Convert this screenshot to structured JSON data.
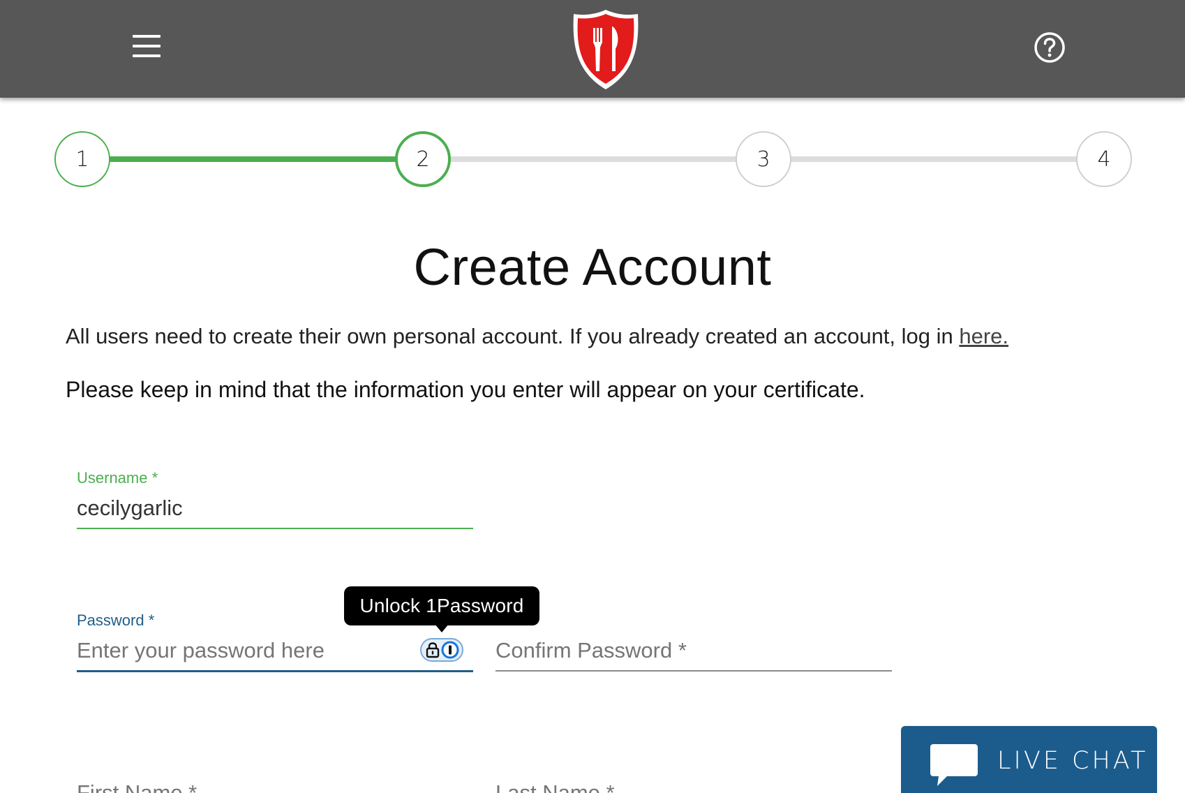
{
  "header": {
    "menu_icon": "hamburger-menu-icon",
    "logo_icon": "shield-fork-knife-logo",
    "help_icon": "question-circle-icon",
    "bar_color": "#575757",
    "logo_color": "#e21b1b"
  },
  "stepper": {
    "current": 2,
    "steps": [
      {
        "label": "1",
        "status": "complete"
      },
      {
        "label": "2",
        "status": "current"
      },
      {
        "label": "3",
        "status": "upcoming"
      },
      {
        "label": "4",
        "status": "upcoming"
      }
    ],
    "active_color": "#4cae4f",
    "inactive_color": "#dcdcdc"
  },
  "main": {
    "title": "Create Account",
    "intro_text": "All users need to create their own personal account. If you already created an account, log in ",
    "login_link": "here.",
    "notice": "Please keep in mind that the information you enter will appear on your certificate."
  },
  "form": {
    "username": {
      "label": "Username *",
      "value": "cecilygarlic"
    },
    "password": {
      "label": "Password *",
      "placeholder": "Enter your password here"
    },
    "confirm_password": {
      "placeholder": "Confirm Password *"
    },
    "first_name": {
      "placeholder": "First Name *"
    },
    "last_name": {
      "placeholder": "Last Name *"
    }
  },
  "onepassword": {
    "tooltip": "Unlock 1Password",
    "lock_icon": "lock-icon",
    "logo_icon": "onepassword-icon"
  },
  "live_chat": {
    "label": "LIVE CHAT",
    "icon": "speech-bubble-icon",
    "color": "#1c5c8d"
  }
}
